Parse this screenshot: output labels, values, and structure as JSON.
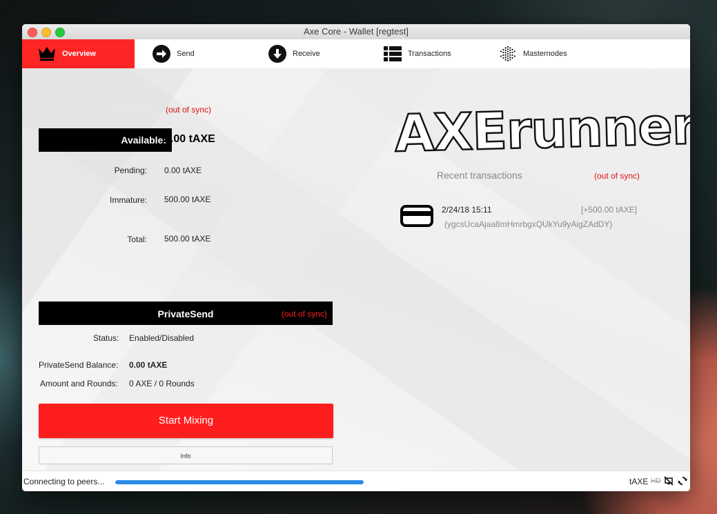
{
  "window": {
    "title": "Axe Core - Wallet [regtest]"
  },
  "tabs": [
    {
      "label": "Overview",
      "icon": "crown-icon"
    },
    {
      "label": "Send",
      "icon": "arrow-right-icon"
    },
    {
      "label": "Receive",
      "icon": "arrow-down-icon"
    },
    {
      "label": "Transactions",
      "icon": "list-icon"
    },
    {
      "label": "Masternodes",
      "icon": "dotted-sphere-icon"
    }
  ],
  "balances": {
    "title": "Balances:",
    "sync_status": "(out of sync)",
    "available_label": "Available:",
    "available_value": "0.00 tAXE",
    "pending_label": "Pending:",
    "pending_value": "0.00 tAXE",
    "immature_label": "Immature:",
    "immature_value": "500.00 tAXE",
    "total_label": "Total:",
    "total_value": "500.00 tAXE"
  },
  "privatesend": {
    "title": "PrivateSend",
    "sync_status": "(out of sync)",
    "status_label": "Status:",
    "status_value": "Enabled/Disabled",
    "balance_label": "PrivateSend Balance:",
    "balance_value": "0.00 tAXE",
    "rounds_label": "Amount and Rounds:",
    "rounds_value": "0 AXE / 0 Rounds",
    "start_button": "Start Mixing",
    "info_button": "Info"
  },
  "logo": {
    "text": "AXErunners"
  },
  "recent": {
    "title": "Recent transactions",
    "sync_status": "(out of sync)",
    "transactions": [
      {
        "date": "2/24/18 15:11",
        "amount": "[+500.00 tAXE]",
        "address": "(ygcsUcaAjaa8mHmrbgxQUkYu9yAigZAdDY)"
      }
    ]
  },
  "statusbar": {
    "text": "Connecting to peers...",
    "progress": 1.0,
    "unit": "tAXE",
    "hd": "HD"
  },
  "colors": {
    "accent": "#ff2525",
    "progress": "#2a8ae5"
  }
}
